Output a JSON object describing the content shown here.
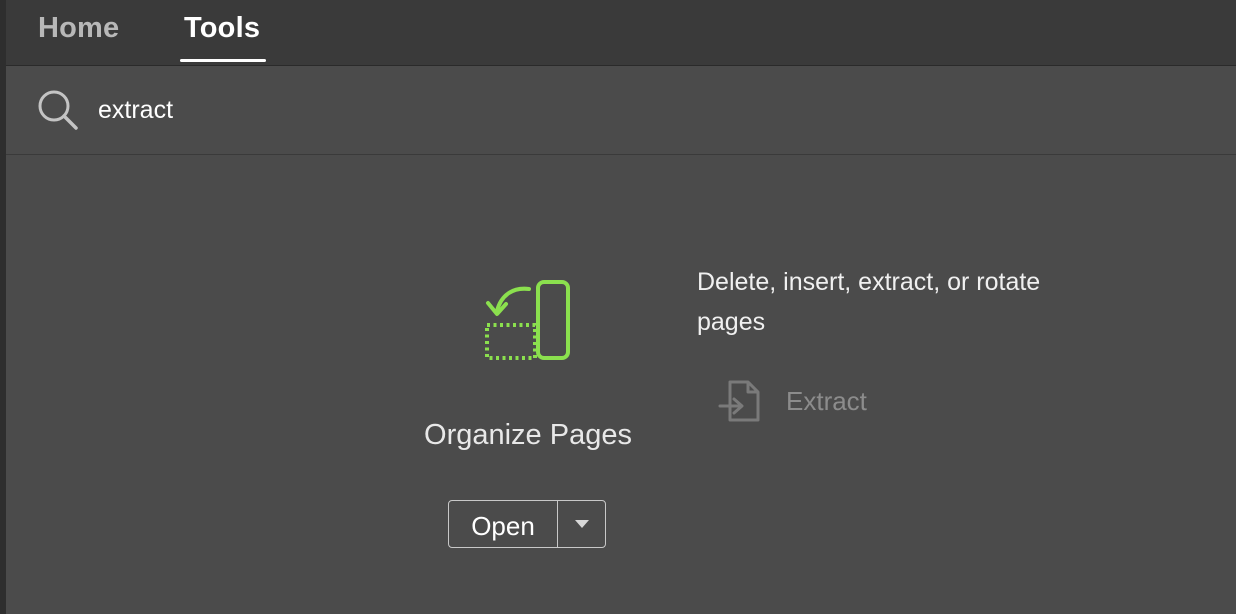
{
  "tabs": {
    "home": "Home",
    "tools": "Tools",
    "active": "Tools"
  },
  "search": {
    "value": "extract",
    "icon": "search-icon"
  },
  "tool": {
    "name": "Organize Pages",
    "icon": "organize-pages-icon",
    "accent_color": "#8be04e",
    "open_label": "Open",
    "menu_icon": "caret-down-icon",
    "description": "Delete, insert, extract, or rotate pages",
    "matches": [
      {
        "label": "Extract",
        "icon": "extract-pages-icon"
      }
    ]
  }
}
